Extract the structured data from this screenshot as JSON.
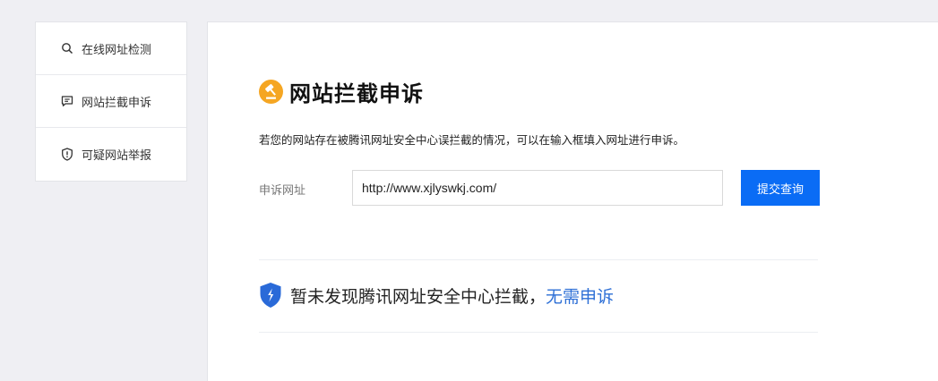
{
  "sidebar": {
    "items": [
      {
        "label": "在线网址检测",
        "icon": "search-icon"
      },
      {
        "label": "网站拦截申诉",
        "icon": "message-icon"
      },
      {
        "label": "可疑网站举报",
        "icon": "shield-alert-icon"
      }
    ]
  },
  "main": {
    "title": "网站拦截申诉",
    "title_icon": "gavel-icon",
    "description": "若您的网站存在被腾讯网址安全中心误拦截的情况，可以在输入框填入网址进行申诉。",
    "form": {
      "label": "申诉网址",
      "url_value": "http://www.xjlyswkj.com/",
      "submit_label": "提交查询"
    },
    "result": {
      "icon": "shield-bolt-icon",
      "message": "暂未发现腾讯网址安全中心拦截，",
      "link_text": "无需申诉"
    }
  },
  "colors": {
    "accent_blue": "#0a6cf5",
    "link_blue": "#2d6fd6",
    "shield_blue": "#2a6ad8",
    "title_icon_orange": "#f5a623"
  }
}
